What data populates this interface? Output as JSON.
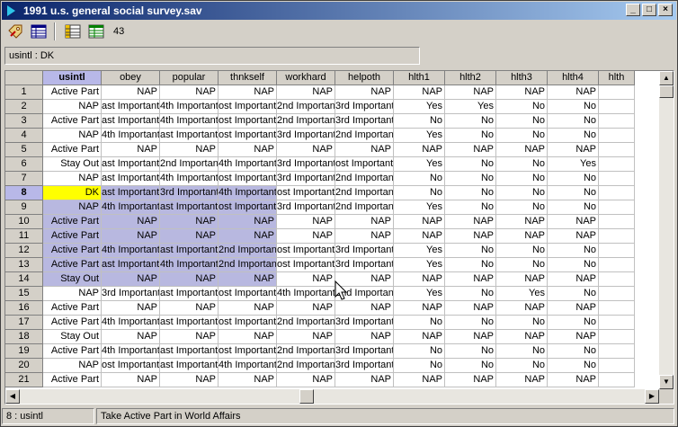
{
  "window": {
    "title": "1991 u.s. general social survey.sav"
  },
  "toolbar": {
    "count": "43"
  },
  "cell_ref": "usintl : DK",
  "columns": [
    "usintl",
    "obey",
    "popular",
    "thnkself",
    "workhard",
    "helpoth",
    "hlth1",
    "hlth2",
    "hlth3",
    "hlth4",
    "hlth"
  ],
  "rows": [
    [
      "1",
      "Active Part",
      "NAP",
      "NAP",
      "NAP",
      "NAP",
      "NAP",
      "NAP",
      "NAP",
      "NAP",
      "NAP"
    ],
    [
      "2",
      "NAP",
      "ast Important",
      "4th Important",
      "ost Important",
      "2nd Important",
      "3rd Important",
      "Yes",
      "Yes",
      "No",
      "No"
    ],
    [
      "3",
      "Active Part",
      "ast Important",
      "4th Important",
      "ost Important",
      "2nd Important",
      "3rd Important",
      "No",
      "No",
      "No",
      "No"
    ],
    [
      "4",
      "NAP",
      "4th Important",
      "ast Important",
      "ost Important",
      "3rd Important",
      "2nd Important",
      "Yes",
      "No",
      "No",
      "No"
    ],
    [
      "5",
      "Active Part",
      "NAP",
      "NAP",
      "NAP",
      "NAP",
      "NAP",
      "NAP",
      "NAP",
      "NAP",
      "NAP"
    ],
    [
      "6",
      "Stay Out",
      "ast Important",
      "2nd Important",
      "4th Important",
      "3rd Important",
      "ost Important",
      "Yes",
      "No",
      "No",
      "Yes"
    ],
    [
      "7",
      "NAP",
      "ast Important",
      "4th Important",
      "ost Important",
      "3rd Important",
      "2nd Important",
      "No",
      "No",
      "No",
      "No"
    ],
    [
      "8",
      "DK",
      "ast Important",
      "3rd Important",
      "4th Important",
      "ost Important",
      "2nd Important",
      "No",
      "No",
      "No",
      "No"
    ],
    [
      "9",
      "NAP",
      "4th Important",
      "ast Important",
      "ost Important",
      "3rd Important",
      "2nd Important",
      "Yes",
      "No",
      "No",
      "No"
    ],
    [
      "10",
      "Active Part",
      "NAP",
      "NAP",
      "NAP",
      "NAP",
      "NAP",
      "NAP",
      "NAP",
      "NAP",
      "NAP"
    ],
    [
      "11",
      "Active Part",
      "NAP",
      "NAP",
      "NAP",
      "NAP",
      "NAP",
      "NAP",
      "NAP",
      "NAP",
      "NAP"
    ],
    [
      "12",
      "Active Part",
      "4th Important",
      "ast Important",
      "2nd Important",
      "ost Important",
      "3rd Important",
      "Yes",
      "No",
      "No",
      "No"
    ],
    [
      "13",
      "Active Part",
      "ast Important",
      "4th Important",
      "2nd Important",
      "ost Important",
      "3rd Important",
      "Yes",
      "No",
      "No",
      "No"
    ],
    [
      "14",
      "Stay Out",
      "NAP",
      "NAP",
      "NAP",
      "NAP",
      "NAP",
      "NAP",
      "NAP",
      "NAP",
      "NAP"
    ],
    [
      "15",
      "NAP",
      "3rd Important",
      "ast Important",
      "ost Important",
      "4th Important",
      "2nd Important",
      "Yes",
      "No",
      "Yes",
      "No"
    ],
    [
      "16",
      "Active Part",
      "NAP",
      "NAP",
      "NAP",
      "NAP",
      "NAP",
      "NAP",
      "NAP",
      "NAP",
      "NAP"
    ],
    [
      "17",
      "Active Part",
      "4th Important",
      "ast Important",
      "ost Important",
      "2nd Important",
      "3rd Important",
      "No",
      "No",
      "No",
      "No"
    ],
    [
      "18",
      "Stay Out",
      "NAP",
      "NAP",
      "NAP",
      "NAP",
      "NAP",
      "NAP",
      "NAP",
      "NAP",
      "NAP"
    ],
    [
      "19",
      "Active Part",
      "4th Important",
      "ast Important",
      "ost Important",
      "2nd Important",
      "3rd Important",
      "No",
      "No",
      "No",
      "No"
    ],
    [
      "20",
      "NAP",
      "ost Important",
      "ast Important",
      "4th Important",
      "2nd Important",
      "3rd Important",
      "No",
      "No",
      "No",
      "No"
    ],
    [
      "21",
      "Active Part",
      "NAP",
      "NAP",
      "NAP",
      "NAP",
      "NAP",
      "NAP",
      "NAP",
      "NAP",
      "NAP"
    ]
  ],
  "selected_row": "8",
  "selected_column": "usintl",
  "status": {
    "cell": "8 : usintl",
    "label": "Take Active Part in World Affairs"
  },
  "colors": {
    "selection": "#b8b8e0",
    "current_cell": "#ffff00",
    "title_start": "#0a246a",
    "title_end": "#a6caf0"
  },
  "icons": {
    "toolbar": [
      "tag-icon",
      "variable-view-icon",
      "value-labels-icon",
      "use-sets-icon"
    ]
  }
}
